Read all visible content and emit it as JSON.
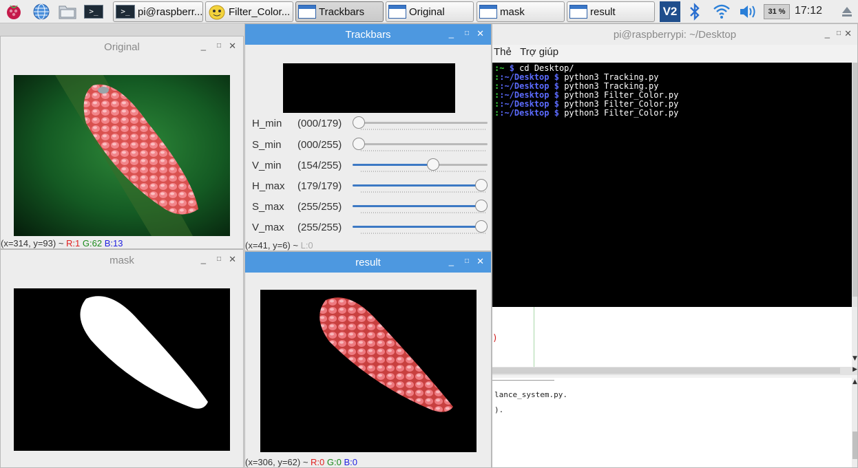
{
  "taskbar": {
    "buttons": [
      {
        "label": "pi@raspberr...",
        "icon": "terminal-icon"
      },
      {
        "label": "Filter_Color...",
        "icon": "python-icon"
      },
      {
        "label": "Trackbars",
        "icon": "window-icon"
      },
      {
        "label": "Original",
        "icon": "window-icon"
      },
      {
        "label": "mask",
        "icon": "window-icon"
      },
      {
        "label": "result",
        "icon": "window-icon"
      }
    ],
    "cpu": "31 %",
    "clock": "17:12",
    "vnc_label": "V2"
  },
  "windows": {
    "original": {
      "title": "Original",
      "status": {
        "coords": "(x=314, y=93) ~",
        "r": "R:1",
        "g": "G:62",
        "b": "B:13"
      }
    },
    "mask": {
      "title": "mask"
    },
    "trackbars": {
      "title": "Trackbars",
      "status": {
        "coords": "(x=41, y=6) ~",
        "l": "L:0"
      },
      "sliders": [
        {
          "name": "H_min",
          "value": "(000/179)",
          "fraction": 0.0
        },
        {
          "name": "S_min",
          "value": "(000/255)",
          "fraction": 0.0
        },
        {
          "name": "V_min",
          "value": "(154/255)",
          "fraction": 0.604
        },
        {
          "name": "H_max",
          "value": "(179/179)",
          "fraction": 1.0
        },
        {
          "name": "S_max",
          "value": "(255/255)",
          "fraction": 1.0
        },
        {
          "name": "V_max",
          "value": "(255/255)",
          "fraction": 1.0
        }
      ]
    },
    "result": {
      "title": "result",
      "status": {
        "coords": "(x=306, y=62) ~",
        "r": "R:0",
        "g": "G:0",
        "b": "B:0"
      }
    },
    "terminal": {
      "title": "pi@raspberrypi: ~/Desktop",
      "menu": [
        "Thẻ",
        "Trợ giúp"
      ],
      "lines": [
        {
          "prompt": ":~",
          "cmd": "cd Desktop/"
        },
        {
          "prompt": ":~/Desktop",
          "cmd": "python3 Tracking.py"
        },
        {
          "prompt": ":~/Desktop",
          "cmd": "python3 Tracking.py"
        },
        {
          "prompt": ":~/Desktop",
          "cmd": "python3 Filter_Color.py"
        },
        {
          "prompt": ":~/Desktop",
          "cmd": "python3 Filter_Color.py"
        },
        {
          "prompt": ":~/Desktop",
          "cmd": "python3 Filter_Color.py"
        }
      ]
    },
    "editor": {
      "paren": ")",
      "lines": [
        "lance_system.py.",
        ")."
      ]
    }
  },
  "colors": {
    "accent": "#4d98e0",
    "terminal_bg": "#000000",
    "prompt_green": "#3bd23b",
    "prompt_blue": "#5b6bff"
  }
}
